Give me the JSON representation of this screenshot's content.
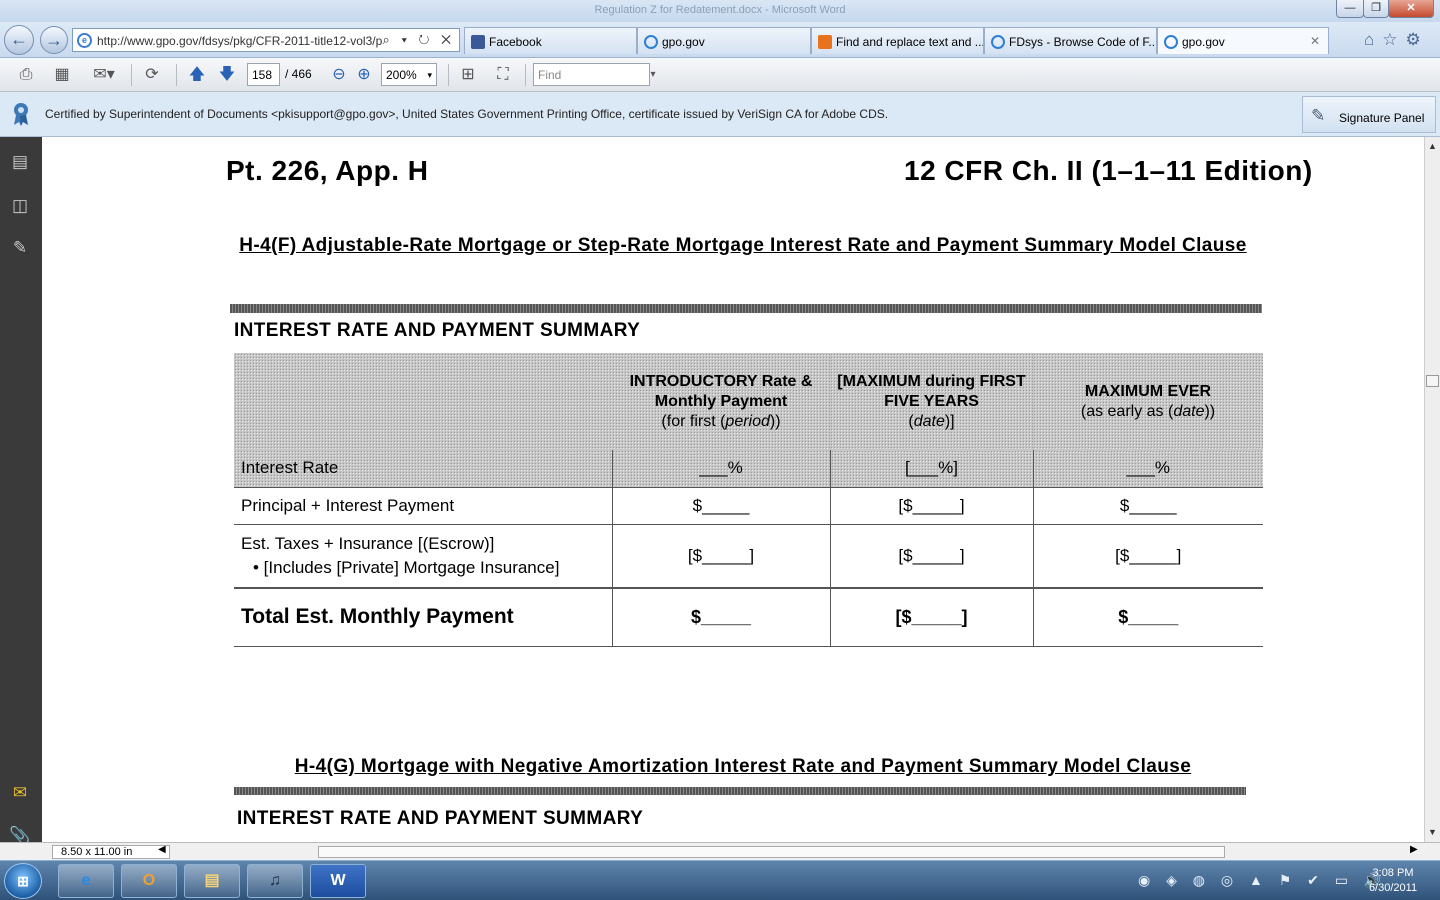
{
  "window": {
    "title": "Regulation Z for Redatement.docx - Microsoft Word",
    "controls": {
      "minimize": "—",
      "maximize": "❐",
      "close": "✕"
    }
  },
  "browser": {
    "address": "http://www.gpo.gov/fdsys/pkg/CFR-2011-title12-vol3/p",
    "address_actions": "⌕ ▾ ↻ ✕",
    "tabs": [
      {
        "label": "Facebook",
        "icon": "facebook-icon",
        "color": "#3b5998"
      },
      {
        "label": "gpo.gov",
        "icon": "ie-icon",
        "color": "#2e7fd3"
      },
      {
        "label": "Find and replace text and ...",
        "icon": "office-icon",
        "color": "#e8731c"
      },
      {
        "label": "FDsys - Browse Code of F...",
        "icon": "ie-icon",
        "color": "#2e7fd3"
      },
      {
        "label": "gpo.gov",
        "icon": "ie-icon",
        "color": "#2e7fd3",
        "close": "✕"
      }
    ],
    "right_icons": "⌂☆⚙"
  },
  "reader": {
    "page_current": "158",
    "page_total": "/ 466",
    "zoom": "200%",
    "find_placeholder": "Find",
    "certificate_text": "Certified by Superintendent of Documents <pkisupport@gpo.gov>, United States Government Printing Office, certificate issued by VeriSign CA for Adobe CDS.",
    "signature_panel": "Signature Panel",
    "page_size": "8.50 x 11.00 in"
  },
  "document": {
    "header_left": "Pt. 226, App. H",
    "header_right": "12 CFR Ch. II (1–1–11 Edition)",
    "section_f_title": "H-4(F)  Adjustable-Rate Mortgage or Step-Rate Mortgage Interest Rate and Payment Summary Model Clause",
    "summary_heading": "INTEREST RATE AND PAYMENT SUMMARY",
    "table": {
      "columns": [
        {
          "title": "INTRODUCTORY Rate & Monthly Payment",
          "sub_prefix": "(for first (",
          "sub_italic": "period",
          "sub_suffix": "))"
        },
        {
          "title": "[MAXIMUM during FIRST FIVE YEARS",
          "sub_prefix": "(",
          "sub_italic": "date",
          "sub_suffix": ")]"
        },
        {
          "title": "MAXIMUM EVER",
          "sub_prefix": "(as early as (",
          "sub_italic": "date",
          "sub_suffix": "))"
        }
      ],
      "rows": [
        {
          "label": "Interest Rate",
          "values": [
            "___%",
            "[___%]",
            "___%"
          ]
        },
        {
          "label": "Principal + Interest Payment",
          "values": [
            "$_____",
            "[$_____]",
            "$_____"
          ]
        },
        {
          "label": "Est. Taxes + Insurance [(Escrow)]",
          "bullet": "• [Includes [Private] Mortgage Insurance]",
          "values": [
            "[$_____]",
            "[$_____]",
            "[$_____]"
          ]
        },
        {
          "label": "Total Est. Monthly Payment",
          "values": [
            "$_____",
            "[$_____]",
            "$_____"
          ]
        }
      ]
    },
    "section_g_title": "H-4(G)  Mortgage with Negative Amortization Interest Rate and Payment Summary Model Clause",
    "summary_heading_g": "INTEREST RATE AND PAYMENT SUMMARY"
  },
  "taskbar": {
    "start": "⊞",
    "apps": [
      {
        "name": "internet-explorer",
        "glyph": "e"
      },
      {
        "name": "outlook",
        "glyph": "O"
      },
      {
        "name": "file-explorer",
        "glyph": "▤"
      },
      {
        "name": "itunes",
        "glyph": "♫"
      },
      {
        "name": "word",
        "glyph": "W"
      }
    ],
    "tray_icons": "◉ ◈ ◍ ◎ ▲ ⚑ ✔ ▭ 🔊",
    "time": "3:08 PM",
    "date": "6/30/2011"
  }
}
